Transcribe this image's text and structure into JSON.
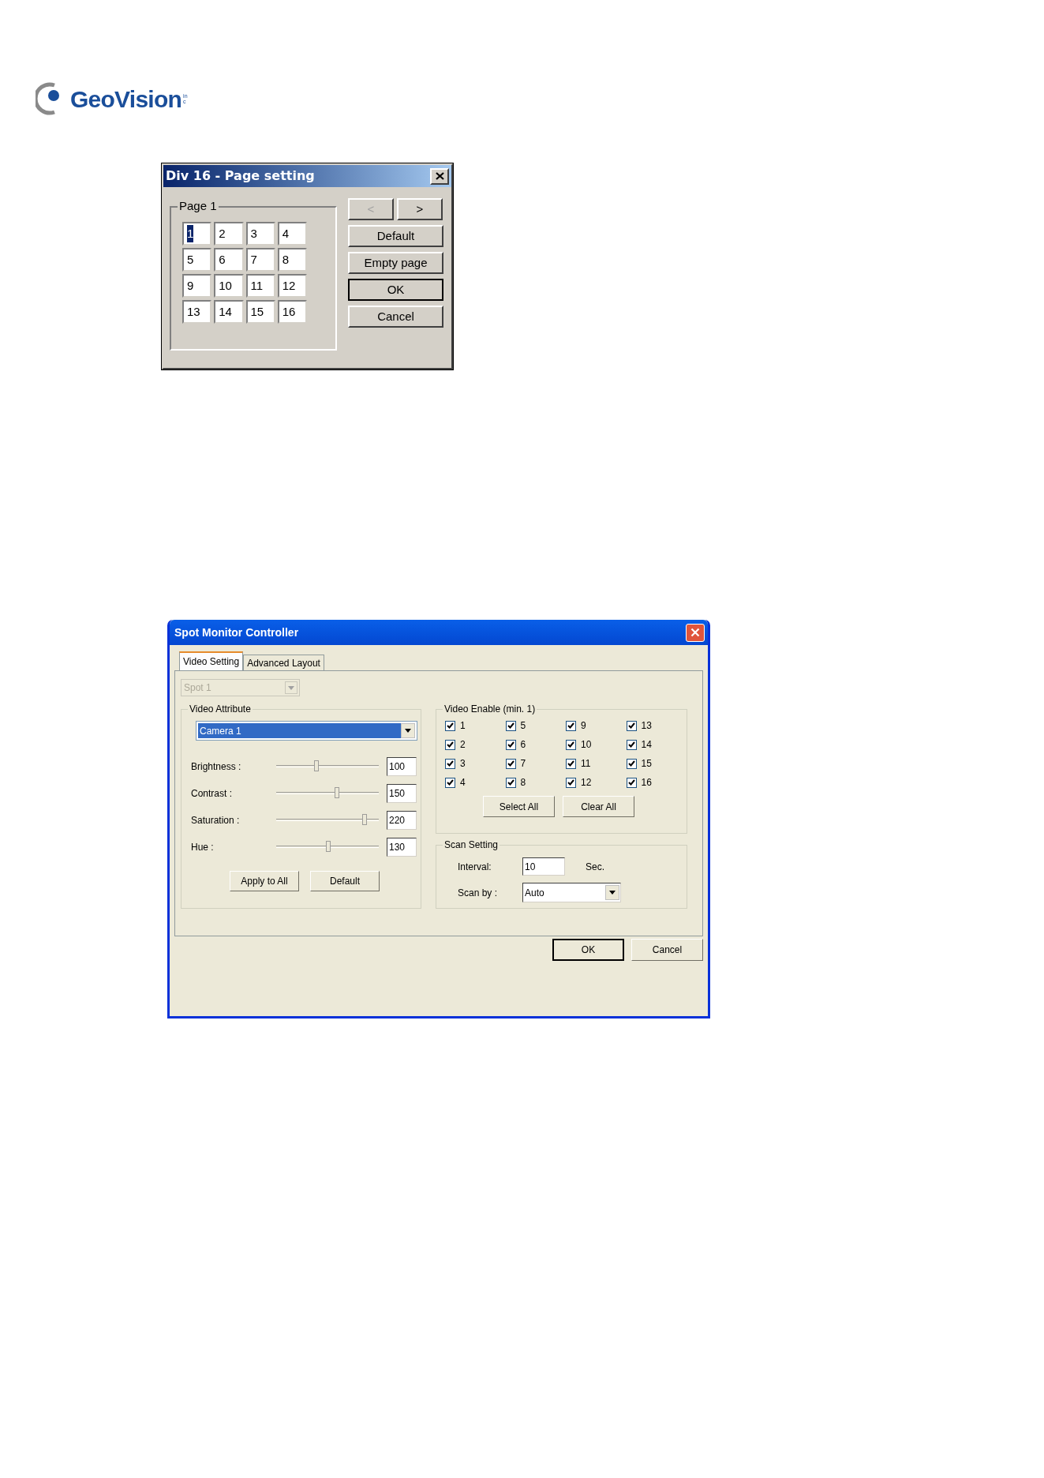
{
  "logo": {
    "name": "GeoVision",
    "suffix": "inc"
  },
  "page_dialog": {
    "title": "Div 16 - Page setting",
    "group": "Page 1",
    "cells": [
      {
        "label": "1",
        "selected": true
      },
      {
        "label": "2",
        "selected": false
      },
      {
        "label": "3",
        "selected": false
      },
      {
        "label": "4",
        "selected": false
      },
      {
        "label": "5",
        "selected": false
      },
      {
        "label": "6",
        "selected": false
      },
      {
        "label": "7",
        "selected": false
      },
      {
        "label": "8",
        "selected": false
      },
      {
        "label": "9",
        "selected": false
      },
      {
        "label": "10",
        "selected": false
      },
      {
        "label": "11",
        "selected": false
      },
      {
        "label": "12",
        "selected": false
      },
      {
        "label": "13",
        "selected": false
      },
      {
        "label": "14",
        "selected": false
      },
      {
        "label": "15",
        "selected": false
      },
      {
        "label": "16",
        "selected": false
      }
    ],
    "nav_buttons": [
      {
        "label": "<",
        "disabled": true
      },
      {
        "label": ">",
        "disabled": false
      }
    ],
    "buttons": [
      {
        "label": "Default",
        "default": false
      },
      {
        "label": "Empty page",
        "default": false
      },
      {
        "label": "OK",
        "default": true
      },
      {
        "label": "Cancel",
        "default": false
      }
    ]
  },
  "spot_dialog": {
    "title": "Spot Monitor Controller",
    "tabs": [
      {
        "label": "Video Setting",
        "selected": true
      },
      {
        "label": "Advanced Layout",
        "selected": false
      }
    ],
    "spot_select": {
      "value": "Spot 1",
      "disabled": true
    },
    "video_attribute": {
      "title": "Video Attribute",
      "camera": "Camera 1",
      "sliders": [
        {
          "label": "Brightness :",
          "level": 0.39,
          "reading": "100"
        },
        {
          "label": "Contrast :",
          "level": 0.59,
          "reading": "150"
        },
        {
          "label": "Saturation :",
          "level": 0.86,
          "reading": "220"
        },
        {
          "label": "Hue :",
          "level": 0.51,
          "reading": "130"
        }
      ],
      "buttons": [
        "Apply to All",
        "Default"
      ]
    },
    "video_enable": {
      "title": "Video Enable (min. 1)",
      "cameras": [
        {
          "label": "1",
          "checked": true
        },
        {
          "label": "2",
          "checked": true
        },
        {
          "label": "3",
          "checked": true
        },
        {
          "label": "4",
          "checked": true
        },
        {
          "label": "5",
          "checked": true
        },
        {
          "label": "6",
          "checked": true
        },
        {
          "label": "7",
          "checked": true
        },
        {
          "label": "8",
          "checked": true
        },
        {
          "label": "9",
          "checked": true
        },
        {
          "label": "10",
          "checked": true
        },
        {
          "label": "11",
          "checked": true
        },
        {
          "label": "12",
          "checked": true
        },
        {
          "label": "13",
          "checked": true
        },
        {
          "label": "14",
          "checked": true
        },
        {
          "label": "15",
          "checked": true
        },
        {
          "label": "16",
          "checked": true
        }
      ],
      "buttons": [
        "Select All",
        "Clear All"
      ]
    },
    "scan_setting": {
      "title": "Scan Setting",
      "interval_label": "Interval:",
      "interval": "10",
      "unit": "Sec.",
      "scan_by_label": "Scan by :",
      "scan_by": "Auto"
    },
    "buttons": [
      {
        "label": "OK",
        "default": true
      },
      {
        "label": "Cancel",
        "default": false
      }
    ]
  }
}
